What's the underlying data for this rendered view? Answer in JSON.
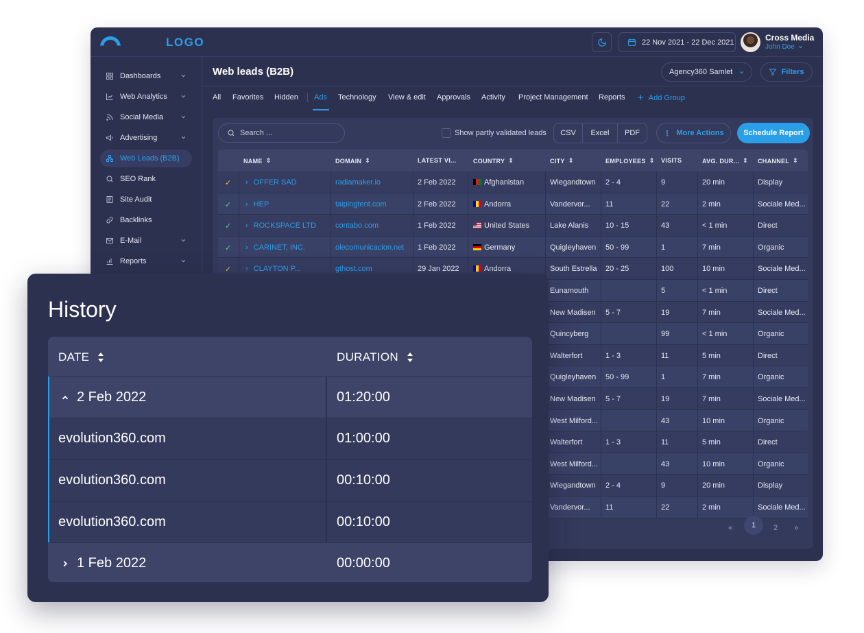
{
  "app": {
    "logo_text": "LOGO",
    "date_range": "22 Nov 2021 - 22 Dec 2021",
    "user": {
      "org": "Cross Media",
      "name": "John Doe"
    }
  },
  "sidebar": {
    "items": [
      {
        "label": "Dashboards",
        "icon": "dashboard-icon",
        "has_chevron": true
      },
      {
        "label": "Web Analytics",
        "icon": "chart-line-icon",
        "has_chevron": true
      },
      {
        "label": "Social Media",
        "icon": "rss-icon",
        "has_chevron": true
      },
      {
        "label": "Advertising",
        "icon": "megaphone-icon",
        "has_chevron": true
      },
      {
        "label": "Web Leads (B2B)",
        "icon": "network-icon",
        "has_chevron": false,
        "active": true
      },
      {
        "label": "SEO Rank",
        "icon": "search-icon",
        "has_chevron": false
      },
      {
        "label": "Site Audit",
        "icon": "audit-icon",
        "has_chevron": false
      },
      {
        "label": "Backlinks",
        "icon": "link-icon",
        "has_chevron": false
      },
      {
        "label": "E-Mail",
        "icon": "mail-icon",
        "has_chevron": true
      },
      {
        "label": "Reports",
        "icon": "bar-chart-icon",
        "has_chevron": true
      }
    ]
  },
  "header": {
    "title": "Web leads (B2B)",
    "agency_select": "Agency360 Samlet",
    "filters_label": "Filters"
  },
  "tabs": {
    "items": [
      "All",
      "Favorites",
      "Hidden",
      "Ads",
      "Technology",
      "View & edit",
      "Approvals",
      "Activity",
      "Project Management",
      "Reports"
    ],
    "active": "Ads",
    "add_group": "Add Group"
  },
  "toolbar": {
    "search_placeholder": "Search ...",
    "partly_validated_label": "Show partly validated leads",
    "export": [
      "CSV",
      "Excel",
      "PDF"
    ],
    "more_actions": "More Actions",
    "schedule_report": "Schedule Report"
  },
  "table": {
    "columns": [
      "NAME",
      "DOMAIN",
      "LATEST VI...",
      "COUNTRY",
      "CITY",
      "EMPLOYEES",
      "VISITS",
      "AVG. DUR...",
      "CHANNEL"
    ],
    "rows": [
      {
        "check": "yellow",
        "name": "OFFER SAD",
        "domain": "radiamaker.io",
        "latest": "2 Feb 2022",
        "country": "Afghanistan",
        "flag": "af",
        "city": "Wiegandtown",
        "employees": "2 - 4",
        "visits": "9",
        "avg": "20 min",
        "channel": "Display"
      },
      {
        "check": "green",
        "name": "HEP",
        "domain": "taipingtent.com",
        "latest": "2 Feb 2022",
        "country": "Andorra",
        "flag": "ad",
        "city": "Vandervor...",
        "employees": "11",
        "visits": "22",
        "avg": "2 min",
        "channel": "Sociale Med..."
      },
      {
        "check": "green",
        "name": "ROCKSPACE LTD",
        "domain": "contabo.com",
        "latest": "1 Feb 2022",
        "country": "United States",
        "flag": "us",
        "city": "Lake Alanis",
        "employees": "10 - 15",
        "visits": "43",
        "avg": "< 1 min",
        "channel": "Direct"
      },
      {
        "check": "green",
        "name": "CARINET, INC.",
        "domain": "olecomunicacion.net",
        "latest": "1 Feb 2022",
        "country": "Germany",
        "flag": "de",
        "city": "Quigleyhaven",
        "employees": "50 - 99",
        "visits": "1",
        "avg": "7 min",
        "channel": "Organic"
      },
      {
        "check": "yellow",
        "name": "CLAYTON P...",
        "domain": "gthost.com",
        "latest": "29 Jan 2022",
        "country": "Andorra",
        "flag": "ad",
        "city": "South Estrella",
        "employees": "20 - 25",
        "visits": "100",
        "avg": "10 min",
        "channel": "Sociale Med..."
      },
      {
        "city": "Eunamouth",
        "employees": "",
        "visits": "5",
        "avg": "< 1 min",
        "channel": "Direct"
      },
      {
        "city": "New Madisen",
        "employees": "5 - 7",
        "visits": "19",
        "avg": "7 min",
        "channel": "Sociale Med..."
      },
      {
        "city": "Quincyberg",
        "employees": "",
        "visits": "99",
        "avg": "< 1 min",
        "channel": "Organic"
      },
      {
        "city": "Walterfort",
        "employees": "1 - 3",
        "visits": "11",
        "avg": "5 min",
        "channel": "Direct"
      },
      {
        "city": "Quigleyhaven",
        "employees": "50 - 99",
        "visits": "1",
        "avg": "7 min",
        "channel": "Organic"
      },
      {
        "city": "New Madisen",
        "employees": "5 - 7",
        "visits": "19",
        "avg": "7 min",
        "channel": "Sociale Med..."
      },
      {
        "city": "West Milford...",
        "employees": "",
        "visits": "43",
        "avg": "10 min",
        "channel": "Organic"
      },
      {
        "city": "Walterfort",
        "employees": "1 - 3",
        "visits": "11",
        "avg": "5 min",
        "channel": "Direct"
      },
      {
        "city": "West Milford...",
        "employees": "",
        "visits": "43",
        "avg": "10 min",
        "channel": "Organic"
      },
      {
        "city": "Wiegandtown",
        "employees": "2 - 4",
        "visits": "9",
        "avg": "20 min",
        "channel": "Display"
      },
      {
        "city": "Vandervor...",
        "employees": "11",
        "visits": "22",
        "avg": "2 min",
        "channel": "Sociale Med..."
      }
    ]
  },
  "pagination": {
    "first": "«",
    "current": "1",
    "next_page": "2",
    "last": "»"
  },
  "history": {
    "title": "History",
    "columns": [
      "DATE",
      "DURATION"
    ],
    "rows": [
      {
        "type": "group",
        "expanded": true,
        "date": "2 Feb 2022",
        "duration": "01:20:00"
      },
      {
        "type": "item",
        "date": "evolution360.com",
        "duration": "01:00:00"
      },
      {
        "type": "item",
        "date": "evolution360.com",
        "duration": "00:10:00"
      },
      {
        "type": "item",
        "date": "evolution360.com",
        "duration": "00:10:00"
      },
      {
        "type": "group",
        "expanded": false,
        "date": "1 Feb 2022",
        "duration": "00:00:00"
      }
    ]
  },
  "colors": {
    "accent": "#2b9ee8",
    "background": "#2c3150",
    "check_green": "#4fd18b",
    "check_yellow": "#f2c230"
  }
}
